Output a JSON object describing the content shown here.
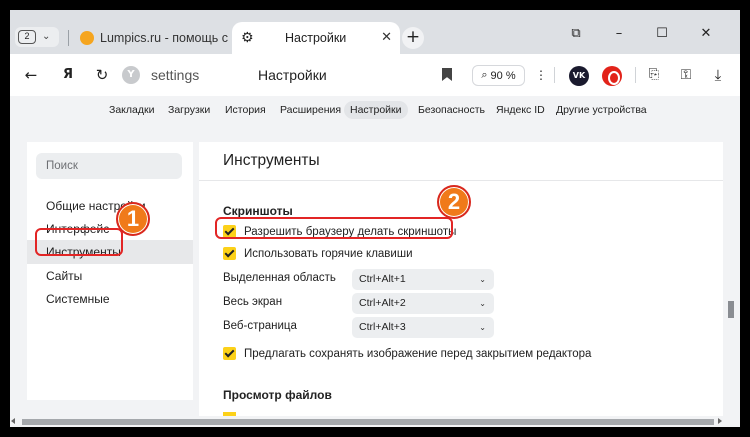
{
  "tabs": {
    "count": "2",
    "items": [
      {
        "title": "Lumpics.ru - помощь с ком"
      },
      {
        "title": "Настройки"
      }
    ]
  },
  "toolbar": {
    "url": "settings",
    "page_title": "Настройки",
    "zoom": "90 %"
  },
  "nav": {
    "items": [
      "Закладки",
      "Загрузки",
      "История",
      "Расширения",
      "Настройки",
      "Безопасность",
      "Яндекс ID",
      "Другие устройства"
    ],
    "active": "Настройки"
  },
  "sidebar": {
    "search_placeholder": "Поиск",
    "items": [
      "Общие настройки",
      "Интерфейс",
      "Инструменты",
      "Сайты",
      "Системные"
    ],
    "active": "Инструменты"
  },
  "main": {
    "title": "Инструменты",
    "screenshots": {
      "heading": "Скриншоты",
      "allow_label": "Разрешить браузеру делать скриншоты",
      "hotkeys_label": "Использовать горячие клавиши",
      "shortcuts": [
        {
          "label": "Выделенная область",
          "value": "Ctrl+Alt+1"
        },
        {
          "label": "Весь экран",
          "value": "Ctrl+Alt+2"
        },
        {
          "label": "Веб-страница",
          "value": "Ctrl+Alt+3"
        }
      ],
      "offer_save_label": "Предлагать сохранять изображение перед закрытием редактора"
    },
    "file_view": {
      "heading": "Просмотр файлов"
    }
  },
  "annotations": {
    "badge1": "1",
    "badge2": "2"
  },
  "colors": {
    "checkbox": "#fcd119",
    "callout": "#e22525",
    "badge": "#f07a1a"
  }
}
